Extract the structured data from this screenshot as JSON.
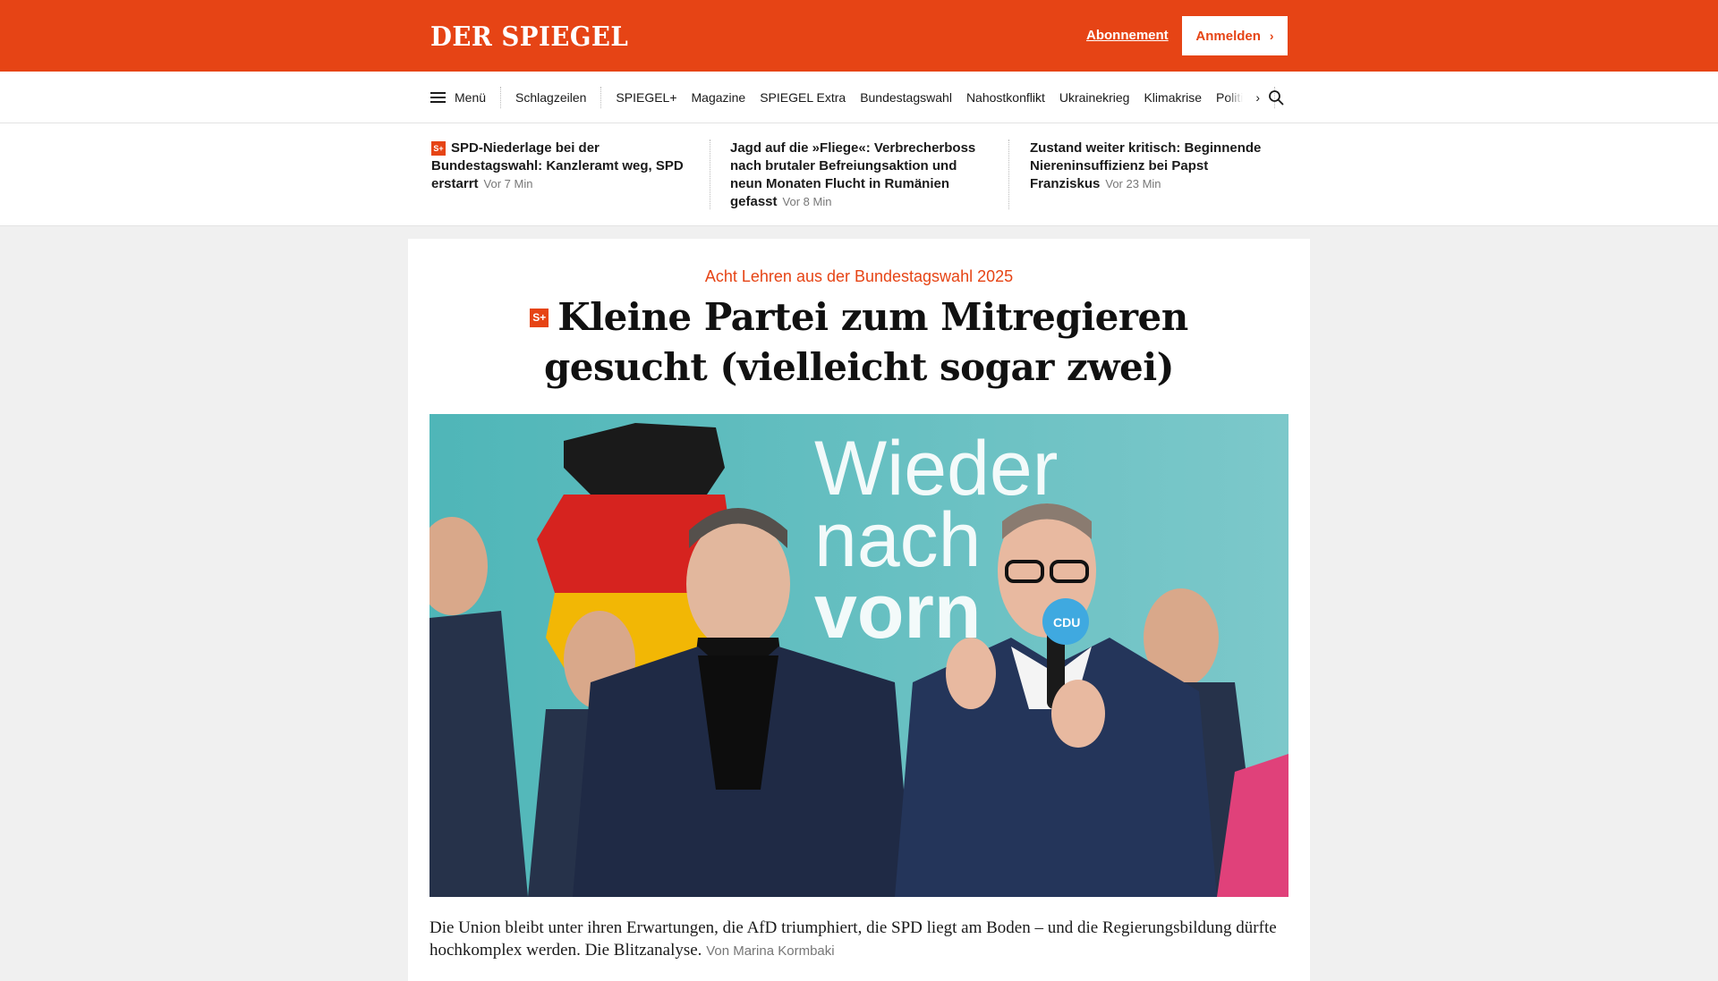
{
  "header": {
    "logo": "DER SPIEGEL",
    "abo_label": "Abonnement",
    "login_label": "Anmelden",
    "brand_color": "#e64415"
  },
  "nav": {
    "menu_label": "Menü",
    "headlines_label": "Schlagzeilen",
    "items": [
      "SPIEGEL+",
      "Magazine",
      "SPIEGEL Extra",
      "Bundestagswahl",
      "Nahostkonflikt",
      "Ukrainekrieg",
      "Klimakrise"
    ],
    "overflow_item": "Politik",
    "next_icon": "chevron-right-icon",
    "search_icon": "search-icon"
  },
  "teasers": [
    {
      "plus_badge": "S+",
      "title": "SPD-Niederlage bei der Bundestagswahl: Kanzleramt weg, SPD erstarrt",
      "time": "Vor 7 Min"
    },
    {
      "title": "Jagd auf die »Fliege«: Verbrecherboss nach brutaler Befreiungsaktion und neun Monaten Flucht in Rumänien gefasst",
      "time": "Vor 8 Min"
    },
    {
      "title": "Zustand weiter kritisch: Beginnende Niereninsuffizienz bei Papst Franziskus",
      "time": "Vor 23 Min"
    }
  ],
  "article": {
    "kicker": "Acht Lehren aus der Bundestagswahl 2025",
    "plus_badge": "S+",
    "headline": "Kleine Partei zum Mitregieren gesucht (vielleicht sogar zwei)",
    "image_text": {
      "line1": "Wieder",
      "line2": "nach",
      "line3": "vorn",
      "mic_label": "CDU"
    },
    "teaser": "Die Union bleibt unter ihren Erwartungen, die AfD triumphiert, die SPD liegt am Boden – und die Regierungsbildung dürfte hochkomplex werden. Die Blitzanalyse.",
    "author": "Von Marina Kormbaki"
  }
}
